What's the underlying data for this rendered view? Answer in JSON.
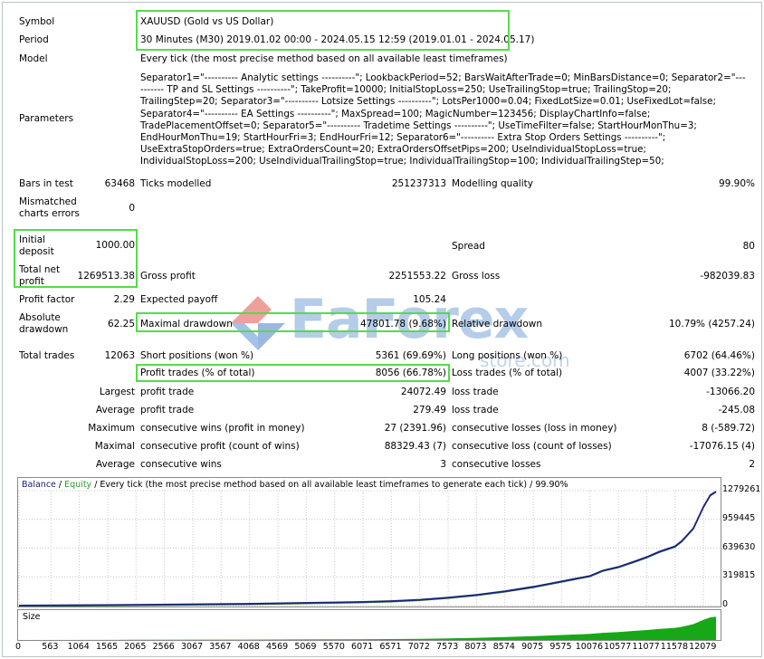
{
  "symbol": {
    "label": "Symbol",
    "value": "XAUUSD (Gold vs US Dollar)"
  },
  "period": {
    "label": "Period",
    "value": "30 Minutes (M30) 2019.01.02 00:00 - 2024.05.15 12:59 (2019.01.01 - 2024.05.17)"
  },
  "model": {
    "label": "Model",
    "value": "Every tick (the most precise method based on all available least timeframes)"
  },
  "parameters": {
    "label": "Parameters",
    "value": "Separator1=\"---------- Analytic settings ----------\"; LookbackPeriod=52; BarsWaitAfterTrade=0; MinBarsDistance=0; Separator2=\"---------- TP and SL Settings ----------\"; TakeProfit=10000; InitialStopLoss=250; UseTrailingStop=true; TrailingStop=20; TrailingStep=20; Separator3=\"---------- Lotsize Settings ----------\"; LotsPer1000=0.04; FixedLotSize=0.01; UseFixedLot=false; Separator4=\"---------- EA Settings ----------\"; MaxSpread=100; MagicNumber=123456; DisplayChartInfo=false; TradePlacementOffset=0; Separator5=\"---------- Tradetime Settings ----------\"; UseTimeFilter=false; StartHourMonThu=3; EndHourMonThu=19; StartHourFri=3; EndHourFri=12; Separator6=\"---------- Extra Stop Orders Settings ----------\"; UseExtraStopOrders=true; ExtraOrdersCount=20; ExtraOrdersOffsetPips=200; UseIndividualStopLoss=true; IndividualStopLoss=200; UseIndividualTrailingStop=true; IndividualTrailingStop=100; IndividualTrailingStep=50;"
  },
  "bars": {
    "label": "Bars in test",
    "value": "63468"
  },
  "ticks": {
    "label": "Ticks modelled",
    "value": "251237313"
  },
  "quality": {
    "label": "Modelling quality",
    "value": "99.90%"
  },
  "mismatched": {
    "label1": "Mismatched",
    "label2": "charts errors",
    "value": "0"
  },
  "initial": {
    "label1": "Initial",
    "label2": "deposit",
    "value": "1000.00"
  },
  "spread": {
    "label": "Spread",
    "value": "80"
  },
  "netprofit": {
    "label1": "Total net",
    "label2": "profit",
    "value": "1269513.38"
  },
  "grossprofit": {
    "label": "Gross profit",
    "value": "2251553.22"
  },
  "grossloss": {
    "label": "Gross loss",
    "value": "-982039.83"
  },
  "pf": {
    "label": "Profit factor",
    "value": "2.29"
  },
  "expected": {
    "label": "Expected payoff",
    "value": "105.24"
  },
  "absdd": {
    "label1": "Absolute",
    "label2": "drawdown",
    "value": "62.25"
  },
  "maxdd": {
    "label": "Maximal drawdown",
    "value": "47801.78 (9.68%)"
  },
  "reldd": {
    "label": "Relative drawdown",
    "value": "10.79% (4257.24)"
  },
  "trades": {
    "label": "Total trades",
    "value": "12063"
  },
  "shortpos": {
    "label": "Short positions (won %)",
    "value": "5361 (69.69%)"
  },
  "longpos": {
    "label": "Long positions (won %)",
    "value": "6702 (64.46%)"
  },
  "profittrades": {
    "label": "Profit trades (% of total)",
    "value": "8056 (66.78%)"
  },
  "losstrades": {
    "label": "Loss trades (% of total)",
    "value": "4007 (33.22%)"
  },
  "largest": {
    "prefix": "Largest",
    "plabel": "profit trade",
    "pvalue": "24072.49",
    "llabel": "loss trade",
    "lvalue": "-13066.20"
  },
  "average": {
    "prefix": "Average",
    "plabel": "profit trade",
    "pvalue": "279.49",
    "llabel": "loss trade",
    "lvalue": "-245.08"
  },
  "maximum": {
    "prefix": "Maximum",
    "plabel": "consecutive wins (profit in money)",
    "pvalue": "27 (2391.96)",
    "llabel": "consecutive losses (loss in money)",
    "lvalue": "8 (-589.72)"
  },
  "maximal": {
    "prefix": "Maximal",
    "plabel": "consecutive profit (count of wins)",
    "pvalue": "88329.43 (7)",
    "llabel": "consecutive loss (count of losses)",
    "lvalue": "-17076.15 (4)"
  },
  "avgcons": {
    "prefix": "Average",
    "plabel": "consecutive wins",
    "pvalue": "3",
    "llabel": "consecutive losses",
    "lvalue": "2"
  },
  "watermark": {
    "text": "EaForex",
    "sub": "store.com"
  },
  "chart": {
    "balance_label": "Balance",
    "sep": " / ",
    "equity_label": "Equity",
    "caption_rest": " / Every tick (the most precise method based on all available least timeframes to generate each tick) / 99.90%",
    "size_label": "Size",
    "colors": {
      "balance": "#1a237e",
      "equity": "#2e7d32",
      "size": "#17a817",
      "highlight": "#53dd48"
    }
  },
  "chart_data": {
    "type": "line",
    "y_ticks": [
      "1279261",
      "959445",
      "639630",
      "319815",
      "0"
    ],
    "x_ticks": [
      "0",
      "563",
      "1064",
      "1565",
      "2065",
      "2566",
      "3067",
      "3567",
      "4068",
      "4569",
      "5069",
      "5570",
      "6071",
      "6571",
      "7072",
      "7573",
      "8073",
      "8574",
      "9075",
      "9575",
      "10076",
      "10577",
      "11077",
      "11578",
      "12079"
    ],
    "ylim": [
      0,
      1279261
    ],
    "xlim": [
      0,
      12300
    ],
    "series": [
      {
        "name": "Balance",
        "x": [
          0,
          2000,
          4000,
          5000,
          6000,
          6571,
          7072,
          7573,
          8073,
          8574,
          9075,
          9575,
          10076,
          10300,
          10577,
          10900,
          11077,
          11300,
          11578,
          11700,
          11900,
          12079,
          12200,
          12300
        ],
        "values": [
          1000,
          9000,
          20000,
          30000,
          40000,
          50000,
          65000,
          90000,
          120000,
          160000,
          210000,
          270000,
          330000,
          390000,
          430000,
          500000,
          540000,
          600000,
          660000,
          720000,
          860000,
          1100000,
          1230000,
          1269513
        ]
      }
    ]
  }
}
